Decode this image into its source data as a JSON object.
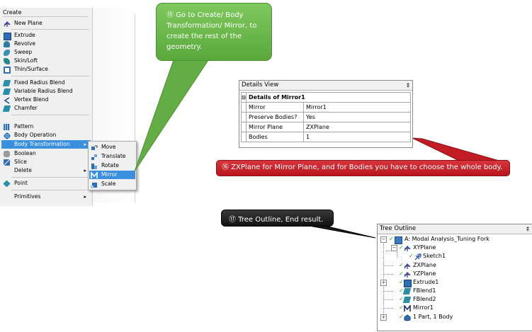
{
  "create_menu": {
    "title": "Create",
    "items": [
      {
        "label": "New Plane",
        "icon": "plane-icon"
      },
      {
        "label": "Extrude",
        "icon": "extrude-icon"
      },
      {
        "label": "Revolve",
        "icon": "revolve-icon"
      },
      {
        "label": "Sweep",
        "icon": "sweep-icon"
      },
      {
        "label": "Skin/Loft",
        "icon": "skin-loft-icon"
      },
      {
        "label": "Thin/Surface",
        "icon": "thin-surface-icon"
      },
      {
        "label": "Fixed Radius Blend",
        "icon": "fixed-blend-icon"
      },
      {
        "label": "Variable Radius Blend",
        "icon": "variable-blend-icon"
      },
      {
        "label": "Vertex Blend",
        "icon": "vertex-blend-icon"
      },
      {
        "label": "Chamfer",
        "icon": "chamfer-icon"
      },
      {
        "label": "Pattern",
        "icon": "pattern-icon"
      },
      {
        "label": "Body Operation",
        "icon": "body-operation-icon"
      },
      {
        "label": "Body Transformation",
        "icon": "",
        "submenu": true,
        "highlighted": true
      },
      {
        "label": "Boolean",
        "icon": "boolean-icon"
      },
      {
        "label": "Slice",
        "icon": "slice-icon"
      },
      {
        "label": "Delete",
        "icon": "",
        "submenu": true
      },
      {
        "label": "Point",
        "icon": "point-icon"
      },
      {
        "label": "Primitives",
        "icon": "",
        "submenu": true
      }
    ],
    "submenu_arrow": "▸",
    "body_transformation_submenu": [
      {
        "label": "Move",
        "icon": "move-icon"
      },
      {
        "label": "Translate",
        "icon": "translate-icon"
      },
      {
        "label": "Rotate",
        "icon": "rotate-icon"
      },
      {
        "label": "Mirror",
        "icon": "mirror-icon",
        "highlighted": true
      },
      {
        "label": "Scale",
        "icon": "scale-icon"
      }
    ]
  },
  "callouts": {
    "step15": "⑮ Go to Create/ Body Transformation/ Mirror, to create the rest of the geometry.",
    "step16": "⑯ ZXPlane for Mirror Plane, and for Bodies you have to choose the whole body.",
    "step17": "⑰ Tree Outline, End result."
  },
  "details_view": {
    "header": "Details View",
    "pin": "‡",
    "group_title": "Details of Mirror1",
    "collapse_glyph": "⊟",
    "rows": [
      {
        "name": "Mirror",
        "value": "Mirror1"
      },
      {
        "name": "Preserve Bodies?",
        "value": "Yes"
      },
      {
        "name": "Mirror Plane",
        "value": "ZXPlane"
      },
      {
        "name": "Bodies",
        "value": "1"
      }
    ]
  },
  "tree_outline": {
    "header": "Tree Outline",
    "pin": "‡",
    "root": "A: Modal Analysis_Tuning Fork",
    "nodes": [
      {
        "label": "XYPlane",
        "icon": "plane-icon"
      },
      {
        "label": "Sketch1",
        "icon": "sketch-icon"
      },
      {
        "label": "ZXPlane",
        "icon": "plane-icon"
      },
      {
        "label": "YZPlane",
        "icon": "plane-icon"
      },
      {
        "label": "Extrude1",
        "icon": "extrude-icon"
      },
      {
        "label": "FBlend1",
        "icon": "blend-icon"
      },
      {
        "label": "FBlend2",
        "icon": "blend-icon"
      },
      {
        "label": "Mirror1",
        "icon": "mirror-icon"
      },
      {
        "label": "1 Part, 1 Body",
        "icon": "body-icon"
      }
    ]
  },
  "colors": {
    "menu_highlight": "#3a8fde",
    "green_callout": "#6ab84c",
    "red_callout": "#c8232a",
    "dark_callout": "#1f1f1f"
  }
}
